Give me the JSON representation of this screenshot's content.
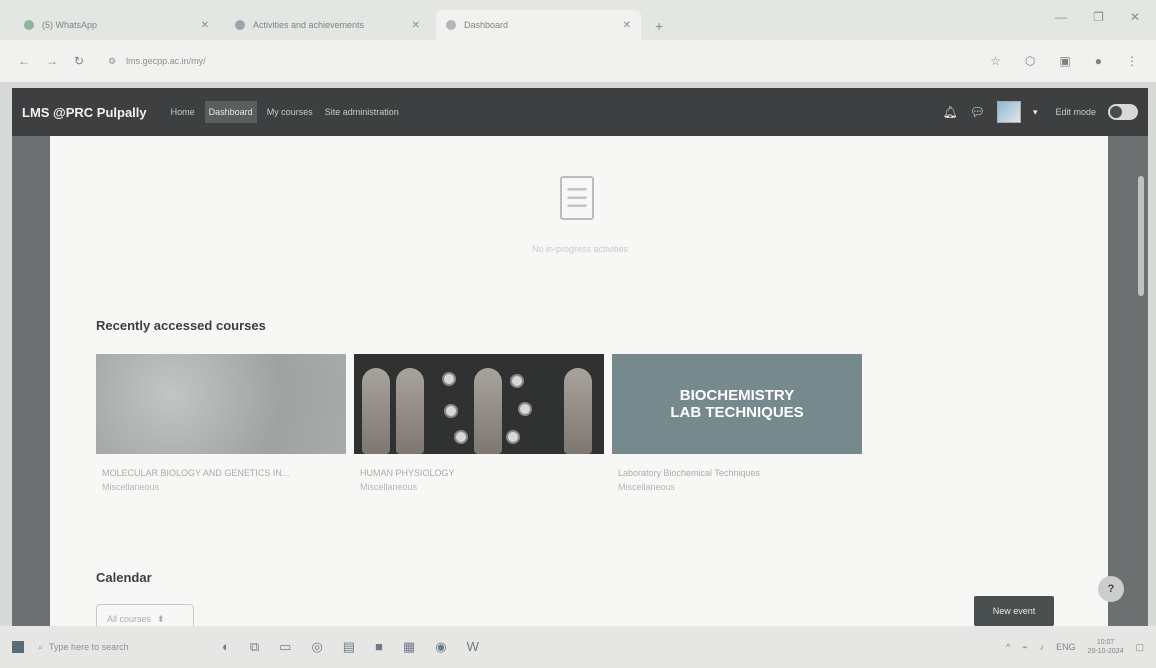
{
  "browser": {
    "tabs": [
      {
        "title": "(5) WhatsApp",
        "active": false
      },
      {
        "title": "Activities and achievements",
        "active": false
      },
      {
        "title": "Dashboard",
        "active": true
      }
    ],
    "new_tab_icon": "plus-icon",
    "window_controls": [
      "minimize-icon",
      "restore-icon",
      "close-icon"
    ],
    "address": "lms.gecpp.ac.in/my/"
  },
  "navbar": {
    "brand": "LMS @PRC Pulpally",
    "links": [
      {
        "label": "Home",
        "active": false
      },
      {
        "label": "Dashboard",
        "active": true
      },
      {
        "label": "My courses",
        "active": false
      },
      {
        "label": "Site administration",
        "active": false
      }
    ],
    "edit_mode_label": "Edit mode",
    "edit_mode_on": false
  },
  "timeline": {
    "empty_text": "No in-progress activities"
  },
  "recent": {
    "title": "Recently accessed courses",
    "courses": [
      {
        "name": "MOLECULAR BIOLOGY AND GENETICS IN...",
        "category": "Miscellaneous"
      },
      {
        "name": "HUMAN PHYSIOLOGY",
        "category": "Miscellaneous"
      },
      {
        "name": "Laboratory Biochemical Techniques",
        "category": "Miscellaneous",
        "banner_line1": "BIOCHEMISTRY",
        "banner_line2": "LAB TECHNIQUES"
      }
    ]
  },
  "calendar": {
    "title": "Calendar",
    "filter_label": "All courses",
    "new_event_label": "New event"
  },
  "help_label": "?",
  "taskbar": {
    "search_placeholder": "Type here to search",
    "time": "10:07",
    "date": "20-10-2024",
    "lang": "ENG"
  }
}
